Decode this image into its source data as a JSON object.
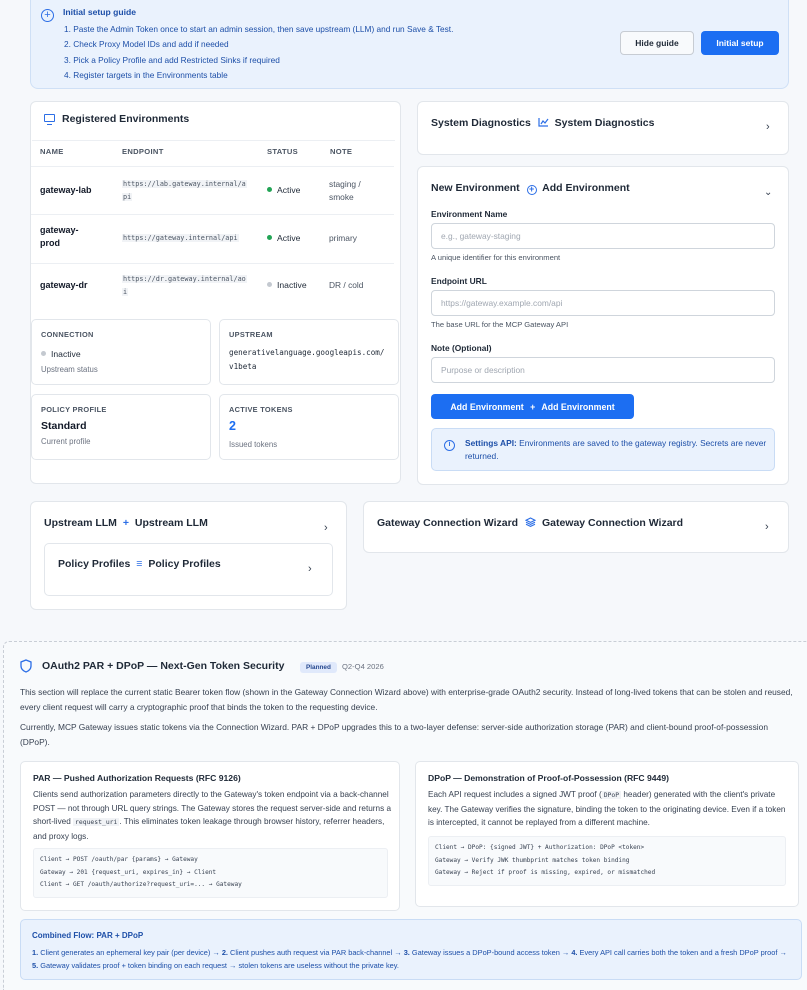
{
  "guide": {
    "title": "Initial setup guide",
    "steps": [
      "1. Paste the Admin Token once to start an admin session, then save upstream (LLM) and run Save & Test.",
      "2. Check Proxy Model IDs and add if needed",
      "3. Pick a Policy Profile and add Restricted Sinks if required",
      "4. Register targets in the Environments table"
    ],
    "hide_label": "Hide guide",
    "setup_label": "Initial setup"
  },
  "environments": {
    "title": "Registered Environments",
    "columns": [
      "NAME",
      "ENDPOINT",
      "STATUS",
      "NOTE"
    ],
    "rows": [
      {
        "name": "gateway-lab",
        "endpoint_l1": "https://lab.gateway.internal/a",
        "endpoint_l2": "pi",
        "status": "Active",
        "note_l1": "staging /",
        "note_l2": "smoke"
      },
      {
        "name_l1": "gateway-",
        "name_l2": "prod",
        "endpoint": "https://gateway.internal/api",
        "status": "Active",
        "note": "primary"
      },
      {
        "name": "gateway-dr",
        "endpoint_l1": "https://dr.gateway.internal/ao",
        "endpoint_l2": "i",
        "status": "Inactive",
        "note": "DR / cold"
      }
    ],
    "connection": {
      "label": "CONNECTION",
      "value": "Inactive",
      "sub": "Upstream status"
    },
    "upstream": {
      "label": "UPSTREAM",
      "value_l1": "generativelanguage.googleapis.com/",
      "value_l2": "v1beta"
    },
    "policy": {
      "label": "POLICY PROFILE",
      "value": "Standard",
      "sub": "Current profile"
    },
    "tokens": {
      "label": "ACTIVE TOKENS",
      "value": "2",
      "sub": "Issued tokens"
    }
  },
  "diagnostics": {
    "title_a": "System Diagnostics",
    "title_b": "System Diagnostics"
  },
  "new_env": {
    "title_a": "New Environment",
    "title_b": "Add Environment",
    "name_label": "Environment Name",
    "name_placeholder": "e.g., gateway-staging",
    "name_help": "A unique identifier for this environment",
    "url_label": "Endpoint URL",
    "url_placeholder": "https://gateway.example.com/api",
    "url_help": "The base URL for the MCP Gateway API",
    "note_label": "Note (Optional)",
    "note_placeholder": "Purpose or description",
    "add_a": "Add Environment",
    "add_b": "Add Environment",
    "info_bold": "Settings API:",
    "info_text": " Environments are saved to the gateway registry. Secrets are never returned."
  },
  "upstream_card": {
    "title_a": "Upstream LLM",
    "title_b": "Upstream LLM"
  },
  "policy_card": {
    "title_a": "Policy Profiles",
    "title_b": "Policy Profiles"
  },
  "wizard": {
    "title_a": "Gateway Connection Wizard",
    "title_b": "Gateway Connection Wizard"
  },
  "oauth": {
    "title": "OAuth2 PAR + DPoP — Next-Gen Token Security",
    "badge": "Planned",
    "quarter": "Q2-Q4 2026",
    "intro": "This section will replace the current static Bearer token flow (shown in the Gateway Connection Wizard above) with enterprise-grade OAuth2 security. Instead of long-lived tokens that can be stolen and reused, every client request will carry a cryptographic proof that binds the token to the requesting device.",
    "current": "Currently, MCP Gateway issues static tokens via the Connection Wizard. PAR + DPoP upgrades this to a two-layer defense: server-side authorization storage (PAR) and client-bound proof-of-possession (DPoP).",
    "par": {
      "title": "PAR — Pushed Authorization Requests (RFC 9126)",
      "text_a": "Clients send authorization parameters directly to the Gateway's token endpoint via a back-channel POST — not through URL query strings. The Gateway stores the request server-side and returns a short-lived ",
      "code": "request_uri",
      "text_b": ". This eliminates token leakage through browser history, referrer headers, and proxy logs.",
      "lines": [
        "Client → POST /oauth/par {params} → Gateway",
        "Gateway → 201 {request_uri, expires_in} → Client",
        "Client → GET /oauth/authorize?request_uri=... → Gateway"
      ]
    },
    "dpop": {
      "title": "DPoP — Demonstration of Proof-of-Possession (RFC 9449)",
      "text_a": "Each API request includes a signed JWT proof (",
      "code": "DPoP",
      "text_b": " header) generated with the client's private key. The Gateway verifies the signature, binding the token to the originating device. Even if a token is intercepted, it cannot be replayed from a different machine.",
      "lines": [
        "Client → DPoP: {signed JWT} + Authorization: DPoP <token>",
        "Gateway → Verify JWK thumbprint matches token binding",
        "Gateway → Reject if proof is missing, expired, or mismatched"
      ]
    },
    "flow_title": "Combined Flow: PAR + DPoP",
    "flow": [
      {
        "n": "1.",
        "t": " Client generates an ephemeral key pair (per device) → "
      },
      {
        "n": "2.",
        "t": " Client pushes auth request via PAR back-channel → "
      },
      {
        "n": "3.",
        "t": " Gateway issues a DPoP-bound access token → "
      },
      {
        "n": "4.",
        "t": " Every API call carries both the token and a fresh DPoP proof → "
      },
      {
        "n": "5.",
        "t": " Gateway validates proof + token binding on each request → stolen tokens are useless without the private key."
      }
    ]
  },
  "colors": {
    "accent": "#1c6ef2",
    "active": "#22a455",
    "inactive": "#c4c9d0"
  }
}
